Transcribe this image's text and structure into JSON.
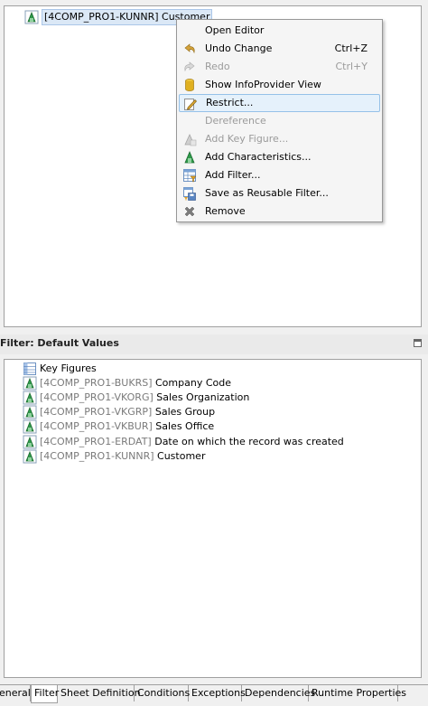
{
  "top_tree": {
    "selected_node": {
      "tech": "[4COMP_PRO1-KUNNR]",
      "name": "Customer"
    }
  },
  "context_menu": {
    "items": [
      {
        "label": "Open Editor",
        "shortcut": "",
        "icon": "none",
        "enabled": true
      },
      {
        "label": "Undo Change",
        "shortcut": "Ctrl+Z",
        "icon": "undo-icon",
        "enabled": true
      },
      {
        "label": "Redo",
        "shortcut": "Ctrl+Y",
        "icon": "redo-icon",
        "enabled": false
      },
      {
        "label": "Show InfoProvider View",
        "shortcut": "",
        "icon": "database-icon",
        "enabled": true
      },
      {
        "label": "Restrict...",
        "shortcut": "",
        "icon": "pencil-icon",
        "enabled": true
      },
      {
        "label": "Dereference",
        "shortcut": "",
        "icon": "none",
        "enabled": false
      },
      {
        "label": "Add Key Figure...",
        "shortcut": "",
        "icon": "key-figure-icon",
        "enabled": false
      },
      {
        "label": "Add Characteristics...",
        "shortcut": "",
        "icon": "characteristic-icon",
        "enabled": true
      },
      {
        "label": "Add Filter...",
        "shortcut": "",
        "icon": "filter-table-icon",
        "enabled": true
      },
      {
        "label": "Save as Reusable Filter...",
        "shortcut": "",
        "icon": "save-filter-icon",
        "enabled": true
      },
      {
        "label": "Remove",
        "shortcut": "",
        "icon": "remove-icon",
        "enabled": true
      }
    ]
  },
  "filter_panel": {
    "title": "Filter: Default Values",
    "tree": [
      {
        "tech": "",
        "name": "Key Figures",
        "icon": "key-figures-table-icon"
      },
      {
        "tech": "[4COMP_PRO1-BUKRS]",
        "name": "Company Code",
        "icon": "characteristic-icon"
      },
      {
        "tech": "[4COMP_PRO1-VKORG]",
        "name": "Sales Organization",
        "icon": "characteristic-icon"
      },
      {
        "tech": "[4COMP_PRO1-VKGRP]",
        "name": "Sales Group",
        "icon": "characteristic-icon"
      },
      {
        "tech": "[4COMP_PRO1-VKBUR]",
        "name": "Sales Office",
        "icon": "characteristic-icon"
      },
      {
        "tech": "[4COMP_PRO1-ERDAT]",
        "name": "Date on which the record was created",
        "icon": "characteristic-icon"
      },
      {
        "tech": "[4COMP_PRO1-KUNNR]",
        "name": "Customer",
        "icon": "characteristic-icon"
      }
    ]
  },
  "tabs": [
    {
      "label": "eneral",
      "active": false
    },
    {
      "label": "Filter",
      "active": true
    },
    {
      "label": "Sheet Definition",
      "active": false
    },
    {
      "label": "Conditions",
      "active": false
    },
    {
      "label": "Exceptions",
      "active": false
    },
    {
      "label": "Dependencies",
      "active": false
    },
    {
      "label": "Runtime Properties",
      "active": false
    }
  ],
  "colors": {
    "characteristic_icon": "#2e9a4a",
    "undo_icon": "#d4a23a",
    "database_icon": "#e0b020",
    "menu_hover": "#e5f1fb"
  }
}
